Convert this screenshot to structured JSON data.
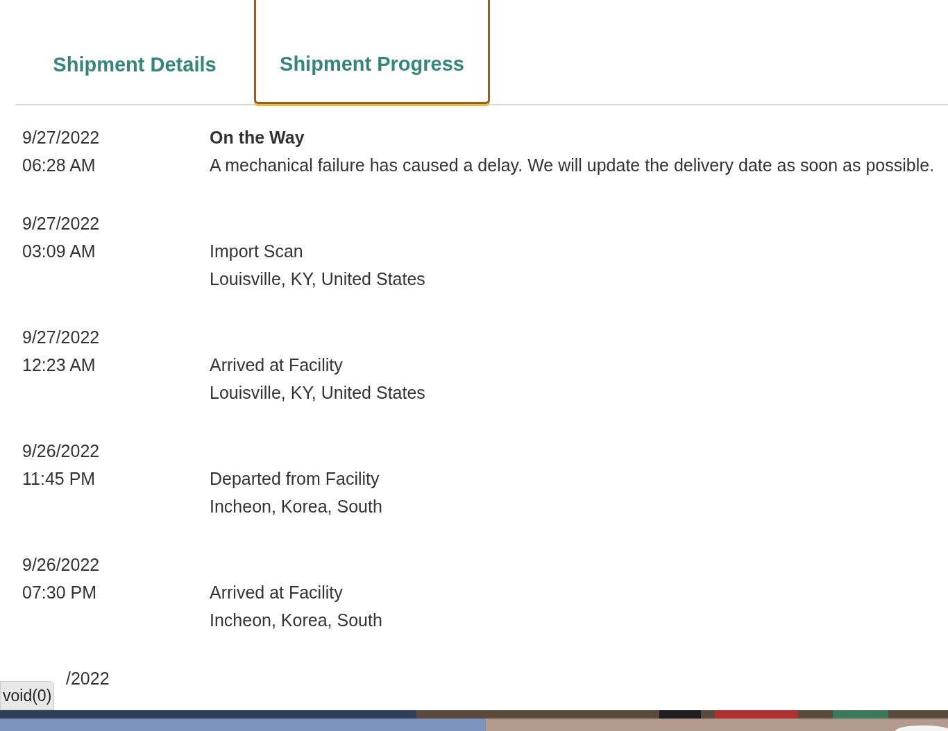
{
  "tabs": [
    {
      "label": "Shipment Details",
      "selected": false
    },
    {
      "label": "Shipment Progress",
      "selected": true
    }
  ],
  "events": [
    {
      "date": "9/27/2022",
      "time": "06:28 AM",
      "title": "On the Way",
      "lines": [
        "A mechanical failure has caused a delay. We will update the delivery date as soon as possible."
      ]
    },
    {
      "date": "9/27/2022",
      "time": "03:09 AM",
      "lines": [
        "Import Scan",
        "Louisville, KY, United States"
      ]
    },
    {
      "date": "9/27/2022",
      "time": "12:23 AM",
      "lines": [
        "Arrived at Facility",
        "Louisville, KY, United States"
      ]
    },
    {
      "date": "9/26/2022",
      "time": "11:45 PM",
      "lines": [
        "Departed from Facility",
        "Incheon, Korea, South"
      ]
    },
    {
      "date": "9/26/2022",
      "time": "07:30 PM",
      "lines": [
        "Arrived at Facility",
        "Incheon, Korea, South"
      ]
    }
  ],
  "partial_date": "/2022",
  "status_tooltip": "void(0)"
}
